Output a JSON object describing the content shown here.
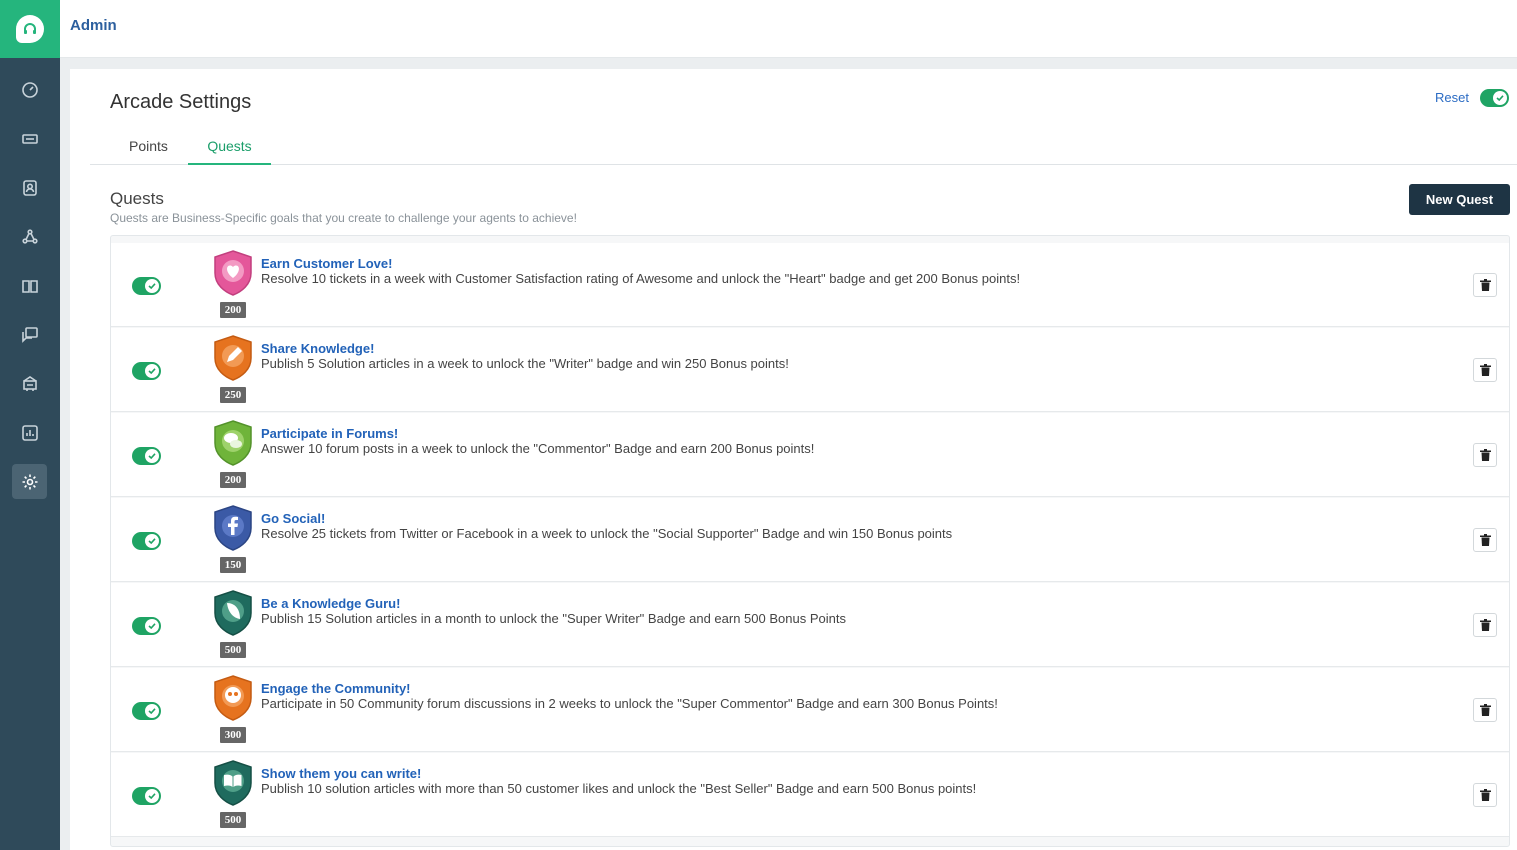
{
  "app": {
    "header_title": "Admin",
    "logo_icon": "headset-logo-icon",
    "brand_color": "#25b57d",
    "sidebar_color": "#2f4a5a"
  },
  "sidebar": {
    "items": [
      {
        "icon": "dashboard-icon",
        "active": false
      },
      {
        "icon": "tickets-icon",
        "active": false
      },
      {
        "icon": "contacts-icon",
        "active": false
      },
      {
        "icon": "social-icon",
        "active": false
      },
      {
        "icon": "solutions-book-icon",
        "active": false
      },
      {
        "icon": "forums-icon",
        "active": false
      },
      {
        "icon": "arcade-icon",
        "active": false
      },
      {
        "icon": "reports-icon",
        "active": false
      },
      {
        "icon": "settings-gear-icon",
        "active": true
      }
    ]
  },
  "page": {
    "title": "Arcade Settings",
    "reset_label": "Reset",
    "reset_enabled": true
  },
  "tabs": [
    {
      "label": "Points",
      "active": false
    },
    {
      "label": "Quests",
      "active": true
    }
  ],
  "quests_section": {
    "title": "Quests",
    "description": "Quests are Business-Specific goals that you create to challenge your agents to achieve!",
    "new_button_label": "New Quest"
  },
  "quests": [
    {
      "title": "Earn Customer Love!",
      "description": "Resolve 10 tickets in a week with Customer Satisfaction rating of Awesome and unlock the \"Heart\" badge and get 200 Bonus points!",
      "points": "200",
      "enabled": true,
      "badge_icon": "heart-badge-icon",
      "badge_color": "#e4579a"
    },
    {
      "title": "Share Knowledge!",
      "description": "Publish 5 Solution articles in a week to unlock the \"Writer\" badge and win 250 Bonus points!",
      "points": "250",
      "enabled": true,
      "badge_icon": "pen-badge-icon",
      "badge_color": "#e6731f"
    },
    {
      "title": "Participate in Forums!",
      "description": "Answer 10 forum posts in a week to unlock the \"Commentor\" Badge and earn 200 Bonus points!",
      "points": "200",
      "enabled": true,
      "badge_icon": "chat-badge-icon",
      "badge_color": "#6fb43a"
    },
    {
      "title": "Go Social!",
      "description": "Resolve 25 tickets from Twitter or Facebook in a week to unlock the \"Social Supporter\" Badge and win 150 Bonus points",
      "points": "150",
      "enabled": true,
      "badge_icon": "facebook-badge-icon",
      "badge_color": "#3b5aa6"
    },
    {
      "title": "Be a Knowledge Guru!",
      "description": "Publish 15 Solution articles in a month to unlock the \"Super Writer\" Badge and earn 500 Bonus Points",
      "points": "500",
      "enabled": true,
      "badge_icon": "quill-badge-icon",
      "badge_color": "#1f6b5e"
    },
    {
      "title": "Engage the Community!",
      "description": "Participate in 50 Community forum discussions in 2 weeks to unlock the \"Super Commentor\" Badge and earn 300 Bonus Points!",
      "points": "300",
      "enabled": true,
      "badge_icon": "quote-badge-icon",
      "badge_color": "#e6731f"
    },
    {
      "title": "Show them you can write!",
      "description": "Publish 10 solution articles with more than 50 customer likes and unlock the \"Best Seller\" Badge and earn 500 Bonus points!",
      "points": "500",
      "enabled": true,
      "badge_icon": "book-badge-icon",
      "badge_color": "#1f6b5e"
    }
  ]
}
